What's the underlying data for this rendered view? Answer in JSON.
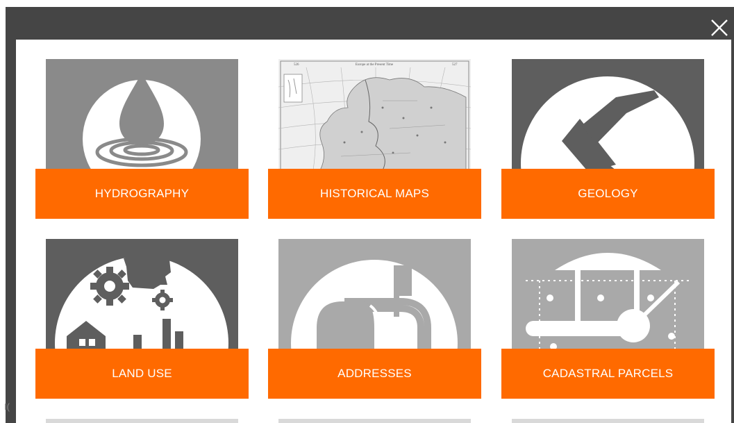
{
  "dialog": {
    "close_icon": "close-icon",
    "stray_char": "I("
  },
  "tiles": [
    {
      "label": "HYDROGRAPHY",
      "icon": "water-drop-icon"
    },
    {
      "label": "HISTORICAL MAPS",
      "icon": "historical-map-thumbnail"
    },
    {
      "label": "GEOLOGY",
      "icon": "rock-hammer-icon"
    },
    {
      "label": "LAND USE",
      "icon": "land-use-icon"
    },
    {
      "label": "ADDRESSES",
      "icon": "mailbox-icon"
    },
    {
      "label": "CADASTRAL PARCELS",
      "icon": "surveyor-parcels-icon"
    }
  ],
  "map_thumbnail": {
    "header_left": "526",
    "header_title": "Europe at the Present Time",
    "header_right": "527"
  },
  "colors": {
    "accent": "#ff6a00",
    "overlay": "#454545",
    "icon_dark": "#5e5e5e",
    "icon_mid": "#8a8a8a",
    "icon_light": "#a9a9a9"
  }
}
